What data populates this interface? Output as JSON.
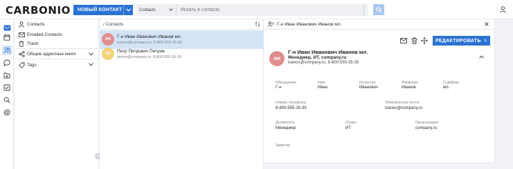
{
  "app": {
    "logo": "CARBONIO"
  },
  "toolbar": {
    "new_button_label": "НОВЫЙ КОНТАКТ",
    "search_module": "Contacts",
    "search_placeholder": "Искать в contacts"
  },
  "rail": {
    "items": [
      "home-icon",
      "calendar-icon",
      "contacts-icon",
      "chat-icon",
      "files-icon",
      "tasks-icon",
      "search-icon",
      "settings-icon"
    ],
    "active_index": 2
  },
  "sidebar": {
    "items": [
      {
        "label": "Contacts",
        "icon": "person-icon"
      },
      {
        "label": "Emailed Contacts",
        "icon": "envelope-icon"
      },
      {
        "label": "Trash",
        "icon": "trash-icon"
      },
      {
        "label": "Общие адресные книги",
        "icon": "share-icon"
      },
      {
        "label": "Tags",
        "icon": "tag-icon"
      }
    ]
  },
  "list": {
    "header": "/ Contacts",
    "contacts": [
      {
        "initials": "ИИ",
        "name": "Г-н Иван Иванович Иванов мл.",
        "sub": "ivanov@company.ru, 8-800-555-35-35",
        "avatar_color": "#e08e8e",
        "selected": true
      },
      {
        "initials": "ПП",
        "name": "Петр Петрович Петров",
        "sub": "petrov@company.ru, 8-800-555-35-35",
        "avatar_color": "#f2d27a",
        "selected": false
      }
    ]
  },
  "detail": {
    "header_title": "Г-н Иван Иванович Иванов мл.",
    "edit_label": "РЕДАКТИРОВАТЬ",
    "card": {
      "initials": "ИИ",
      "name": "Г-н Иван Иванович Иванов мл.",
      "sub": "Менеджер, ИТ, company.ru",
      "contact_line": "ivanov@company.ru, 8-800-555-35-35"
    },
    "fields": {
      "prefix_label": "Обращение",
      "prefix": "Г-н",
      "first_label": "Имя",
      "first": "Иван",
      "middle_label": "Отчество",
      "middle": "Иванович",
      "last_label": "Фамилия",
      "last": "Иванов",
      "suffix_label": "Суффикс",
      "suffix": "мл.",
      "phone_label": "Номер телефона",
      "phone": "8-800-555-35-35",
      "email_label": "Электронная почта",
      "email": "ivanov@company.ru",
      "job_label": "Должность",
      "job": "Менеджер",
      "dept_label": "Отдел",
      "dept": "ИТ",
      "org_label": "Организация",
      "org": "company.ru",
      "notes_label": "Заметки"
    }
  },
  "colors": {
    "accent": "#2b73d2",
    "selected_row": "#d5e3f6"
  }
}
